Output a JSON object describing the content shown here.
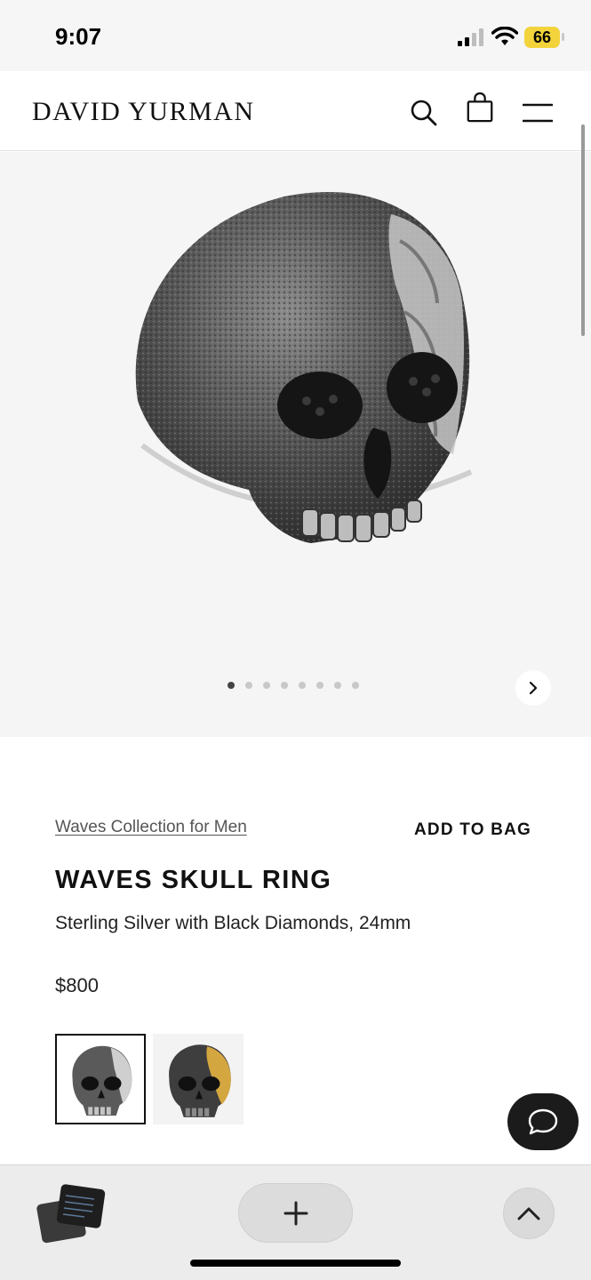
{
  "status_bar": {
    "time": "9:07",
    "battery": "66"
  },
  "header": {
    "brand": "DAVID YURMAN"
  },
  "hero": {
    "image_count": 8,
    "active_index": 0
  },
  "product": {
    "collection_link": "Waves Collection for Men",
    "add_to_bag": "ADD TO BAG",
    "title": "WAVES SKULL RING",
    "subtitle": "Sterling Silver with Black Diamonds, 24mm",
    "price": "$800"
  },
  "icons": {
    "search": "search-icon",
    "bag": "shopping-bag-icon",
    "menu": "hamburger-menu-icon",
    "next": "chevron-right-icon",
    "chat": "chat-bubble-icon",
    "new_tab": "plus-icon",
    "scroll_top": "chevron-up-icon"
  },
  "colors": {
    "battery": "#f2d33c",
    "chat_button": "#1b1b1b"
  }
}
